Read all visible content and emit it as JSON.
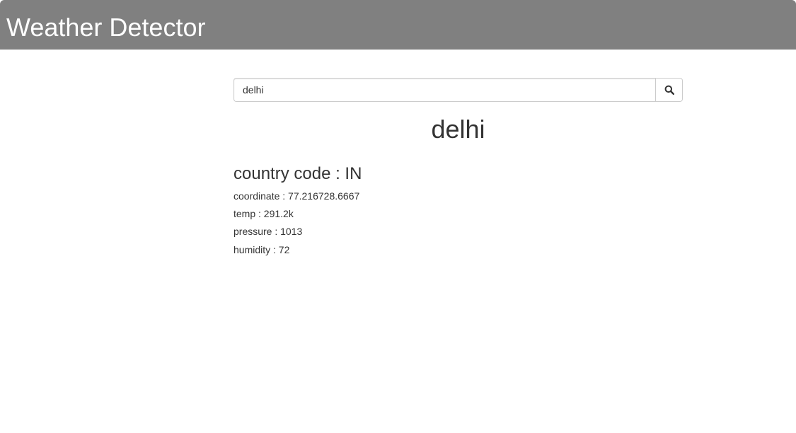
{
  "header": {
    "title": "Weather Detector"
  },
  "search": {
    "value": "delhi",
    "button_icon": "search-icon"
  },
  "result": {
    "city": "delhi",
    "country_code": "country code : IN",
    "coordinate": "coordinate : 77.216728.6667",
    "temp": "temp : 291.2k",
    "pressure": "pressure : 1013",
    "humidity": "humidity : 72"
  },
  "colors": {
    "header_bg": "#808080",
    "header_text": "#ffffff",
    "text": "#333333",
    "border": "#cccccc"
  }
}
